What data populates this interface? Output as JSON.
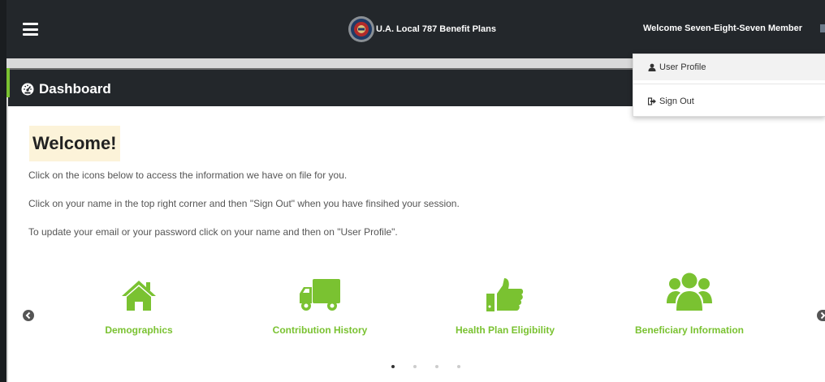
{
  "header": {
    "brand_title": "U.A. Local 787 Benefit Plans",
    "user_greeting": "Welcome Seven-Eight-Seven Member"
  },
  "user_menu": {
    "items": [
      {
        "label": "User Profile",
        "icon": "user-icon"
      },
      {
        "label": "Sign Out",
        "icon": "sign-out-icon"
      }
    ]
  },
  "panel": {
    "title": "Dashboard",
    "title_icon": "dashboard-icon"
  },
  "content": {
    "welcome": "Welcome!",
    "lines": [
      "Click on the icons below to access the information we have on file for you.",
      "Click on your name in the top right corner and then \"Sign Out\" when you have finsihed your session.",
      "To update your email or your password click on your name and then on \"User Profile\"."
    ]
  },
  "carousel": {
    "tiles": [
      {
        "label": "Demographics",
        "icon": "home-icon"
      },
      {
        "label": "Contribution History",
        "icon": "truck-icon"
      },
      {
        "label": "Health Plan Eligibility",
        "icon": "thumbs-up-icon"
      },
      {
        "label": "Beneficiary Information",
        "icon": "users-icon"
      }
    ],
    "page_count": 4,
    "active_page": 1
  },
  "colors": {
    "navbar": "#23272b",
    "accent_green": "#7ac231",
    "welcome_highlight": "#fcf3d9",
    "background": "#d9d9d9"
  }
}
